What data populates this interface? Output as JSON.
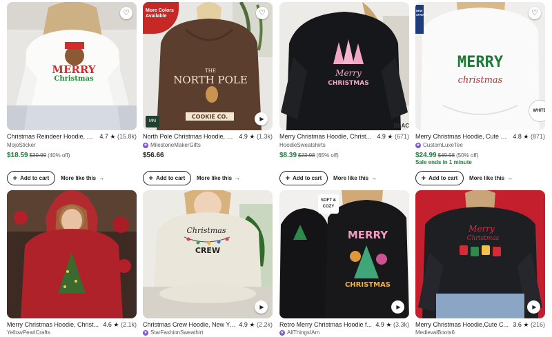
{
  "listings": [
    {
      "title": "Christmas Reindeer Hoodie, Chr...",
      "rating": "4.7",
      "reviews": "(15.8k)",
      "shop": "MojoSticker",
      "star_seller": false,
      "price": "$18.59",
      "original_price": "$30.99",
      "discount": "(40% off)",
      "sale_ends": "",
      "show_cart": true,
      "image_text": "Merry Christmas",
      "badges": {
        "fav": true
      }
    },
    {
      "title": "North Pole Christmas Hoodie, C...",
      "rating": "4.9",
      "reviews": "(1.3k)",
      "shop": "MilestoneMakerGifts",
      "star_seller": true,
      "price": "$56.66",
      "original_price": "",
      "discount": "",
      "sale_ends": "",
      "show_cart": true,
      "image_text": "THE NORTH POLE EST. 1886 COOKIE CO. BAKED FRESH DAILY",
      "badges": {
        "more_colors": "More Colors Available",
        "mm": "MM",
        "fav": true,
        "play": true
      }
    },
    {
      "title": "Merry Christmas Hoodie, Christ...",
      "rating": "4.9",
      "reviews": "(671)",
      "shop": "HoodieSweatshirts",
      "star_seller": false,
      "price": "$8.39",
      "original_price": "$23.98",
      "discount": "(65% off)",
      "sale_ends": "",
      "show_cart": true,
      "image_text": "Merry CHRISTMAS",
      "badges": {
        "corner_word": "BLAC"
      }
    },
    {
      "title": "Merry Christmas Hoodie, Cute C...",
      "rating": "4.8",
      "reviews": "(871)",
      "shop": "CustomLuxeTee",
      "star_seller": true,
      "price": "$24.99",
      "original_price": "$49.98",
      "discount": "(50% off)",
      "sale_ends": "Sale ends in 1 minute",
      "show_cart": true,
      "image_text": "MERRY christmas",
      "badges": {
        "white": "WHITE",
        "fav": true,
        "strip": "NEW SPRING"
      }
    },
    {
      "title": "Merry Christmas Hoodie, Christ...",
      "rating": "4.6",
      "reviews": "(2.1k)",
      "shop": "YellowPearlCrafts",
      "star_seller": false,
      "image_text": "",
      "badges": {}
    },
    {
      "title": "Christmas Crew Hoodie, New Ye...",
      "rating": "4.9",
      "reviews": "(2.2k)",
      "shop": "StarFashionSweathirt",
      "star_seller": true,
      "image_text": "Christmas CREW",
      "badges": {
        "play": true
      }
    },
    {
      "title": "Retro Merry Christmas Hoodie f...",
      "rating": "4.9",
      "reviews": "(3.3k)",
      "shop": "AllThingsIAm",
      "star_seller": true,
      "image_text": "MERRY CHRISTMAS",
      "badges": {
        "soft": "SOFT & COZY",
        "play": true
      }
    },
    {
      "title": "Merry Christmas Hoodie,Cute C...",
      "rating": "3.6",
      "reviews": "(216)",
      "shop": "MedievalBoots6",
      "star_seller": false,
      "image_text": "Merry Christmas",
      "badges": {
        "play": true
      }
    }
  ],
  "ui": {
    "add_to_cart": "Add to cart",
    "more_like_this": "More like this",
    "star": "★",
    "play_icon": "▶",
    "heart_icon": "♡",
    "arrow_icon": "→",
    "plus_icon": "+"
  },
  "colors": {
    "sale_green": "#1a7f3b",
    "star_seller_purple": "#7f59c9",
    "badge_red": "#c62826"
  }
}
